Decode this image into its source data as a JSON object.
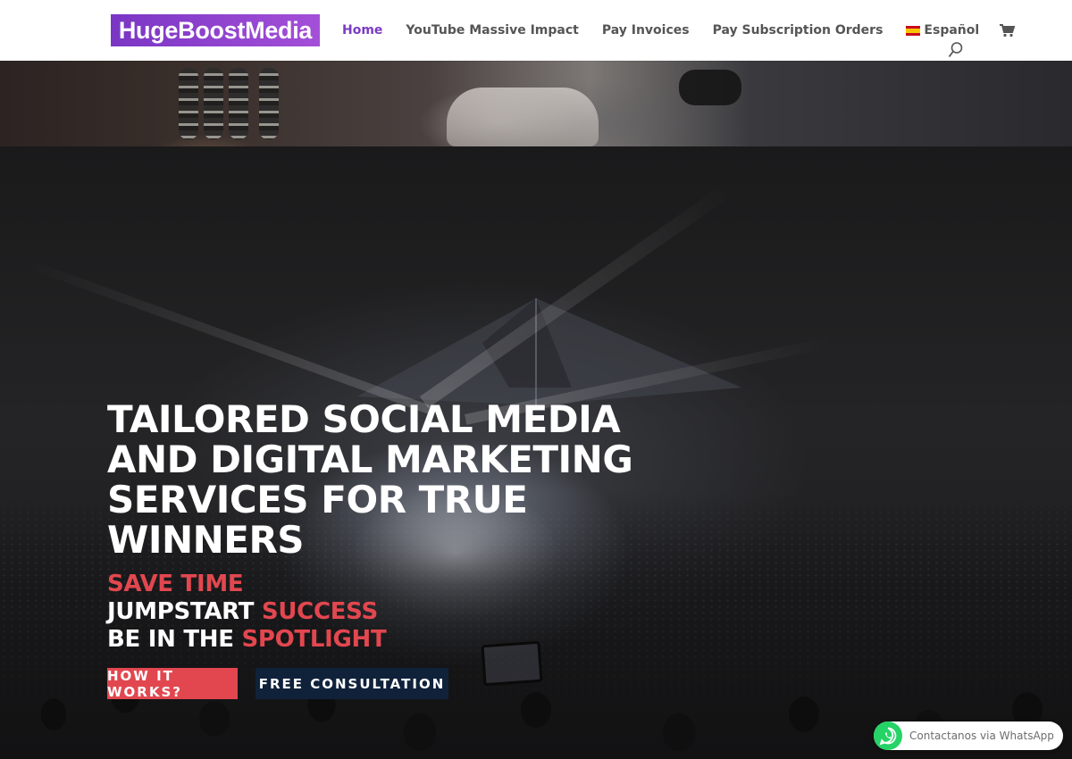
{
  "header": {
    "logo_text": "HugeBoostMedia",
    "nav": [
      {
        "label": "Home",
        "active": true
      },
      {
        "label": "YouTube Massive Impact",
        "active": false
      },
      {
        "label": "Pay Invoices",
        "active": false
      },
      {
        "label": "Pay Subscription Orders",
        "active": false
      }
    ],
    "language": {
      "label": "Español",
      "icon": "spain-flag-icon"
    },
    "cart_icon": "cart-icon",
    "search_icon": "search-icon"
  },
  "hero": {
    "headline": "TAILORED SOCIAL MEDIA AND DIGITAL MARKETING SERVICES FOR TRUE WINNERS",
    "taglines": {
      "line1_accent": "SAVE TIME",
      "line2_text": "JUMPSTART ",
      "line2_accent": "SUCCESS",
      "line3_text": "BE IN THE ",
      "line3_accent": "SPOTLIGHT"
    },
    "buttons": {
      "primary": "HOW IT WORKS?",
      "secondary": "FREE CONSULTATION"
    }
  },
  "whatsapp": {
    "label": "Contactanos via WhatsApp",
    "icon": "whatsapp-icon"
  },
  "colors": {
    "brand_purple": "#7b3cc4",
    "accent_red": "#e2474f",
    "navy": "#10223a",
    "whatsapp_green": "#25d366"
  }
}
